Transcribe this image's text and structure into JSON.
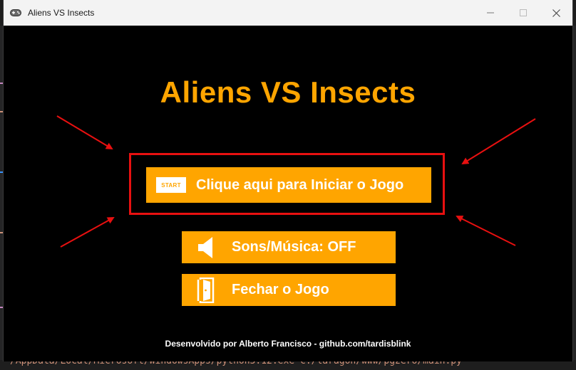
{
  "window": {
    "title": "Aliens VS Insects",
    "minimize_label": "—",
    "maximize_label": "☐",
    "close_label": "✕"
  },
  "game": {
    "title": "Aliens VS Insects",
    "start_badge": "START",
    "start_label": "Clique aqui para Iniciar o Jogo",
    "sound_label": "Sons/Música: OFF",
    "close_label": "Fechar o Jogo",
    "footer": "Desenvolvido por Alberto Francisco - github.com/tardisblink"
  },
  "background": {
    "terminal_text": "/AppData/Local/Microsoft/WindowsApps/python3.12.exe c:/laragon/www/pgzero/main.py"
  },
  "colors": {
    "accent": "#ffa500",
    "highlight": "#e81010",
    "game_bg": "#000000"
  },
  "icons": [
    "gamepad-icon",
    "speaker-icon",
    "door-icon"
  ]
}
